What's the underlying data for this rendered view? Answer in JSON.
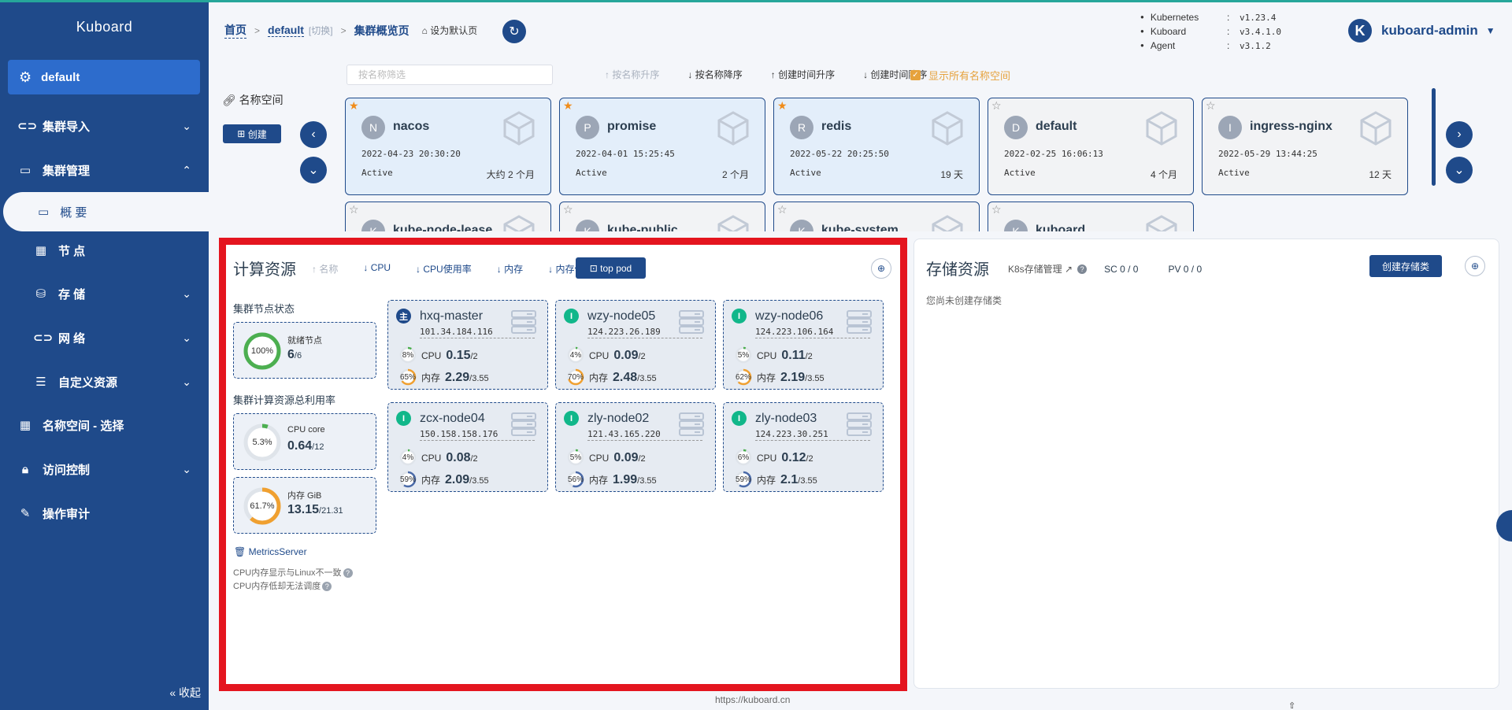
{
  "brand": "Kuboard",
  "sidebar": {
    "namespace": "default",
    "items": [
      {
        "label": "集群导入"
      },
      {
        "label": "集群管理"
      },
      {
        "label": "概 要"
      },
      {
        "label": "节 点"
      },
      {
        "label": "存 储"
      },
      {
        "label": "网 络"
      },
      {
        "label": "自定义资源"
      },
      {
        "label": "名称空间 - 选择"
      },
      {
        "label": "访问控制"
      },
      {
        "label": "操作审计"
      }
    ],
    "collapse": "收起"
  },
  "header": {
    "crumb_home": "首页",
    "crumb_cluster": "default",
    "crumb_switch": "[切换]",
    "crumb_current": "集群概览页",
    "set_default": "设为默认页",
    "versions": [
      {
        "name": "Kubernetes",
        "value": "v1.23.4"
      },
      {
        "name": "Kuboard",
        "value": "v3.4.1.0"
      },
      {
        "name": "Agent",
        "value": "v3.1.2"
      }
    ],
    "user_initial": "K",
    "user": "kuboard-admin"
  },
  "namespaces": {
    "label": "名称空间",
    "create": "创建",
    "filter_placeholder": "按名称筛选",
    "sorts": [
      "按名称升序",
      "按名称降序",
      "创建时间升序",
      "创建时间降序"
    ],
    "show_all": "显示所有名称空间",
    "cards": [
      {
        "initial": "N",
        "name": "nacos",
        "created": "2022-04-23 20:30:20",
        "status": "Active",
        "age": "大约 2 个月",
        "fav": true
      },
      {
        "initial": "P",
        "name": "promise",
        "created": "2022-04-01 15:25:45",
        "status": "Active",
        "age": "2 个月",
        "fav": true
      },
      {
        "initial": "R",
        "name": "redis",
        "created": "2022-05-22 20:25:50",
        "status": "Active",
        "age": "19 天",
        "fav": true
      },
      {
        "initial": "D",
        "name": "default",
        "created": "2022-02-25 16:06:13",
        "status": "Active",
        "age": "4 个月",
        "fav": false
      },
      {
        "initial": "I",
        "name": "ingress-nginx",
        "created": "2022-05-29 13:44:25",
        "status": "Active",
        "age": "12 天",
        "fav": false
      },
      {
        "initial": "K",
        "name": "kube-node-lease",
        "created": "",
        "status": "",
        "age": "",
        "fav": false
      },
      {
        "initial": "K",
        "name": "kube-public",
        "created": "",
        "status": "",
        "age": "",
        "fav": false
      },
      {
        "initial": "K",
        "name": "kube-system",
        "created": "",
        "status": "",
        "age": "",
        "fav": false
      },
      {
        "initial": "K",
        "name": "kuboard",
        "created": "",
        "status": "",
        "age": "",
        "fav": false
      }
    ]
  },
  "compute": {
    "title": "计算资源",
    "sorts": [
      "名称",
      "CPU",
      "CPU使用率",
      "内存",
      "内存使用率"
    ],
    "top_pod": "top pod",
    "node_status_title": "集群节点状态",
    "ready": {
      "label": "就绪节点",
      "pct": 100,
      "pct_text": "100%",
      "value": "6",
      "total": "/6"
    },
    "usage_title": "集群计算资源总利用率",
    "cpu": {
      "label": "CPU core",
      "pct": 5.3,
      "pct_text": "5.3%",
      "value": "0.64",
      "total": "/12"
    },
    "mem": {
      "label": "内存 GiB",
      "pct": 61.7,
      "pct_text": "61.7%",
      "value": "13.15",
      "total": "/21.31"
    },
    "metrics_server": "MetricsServer",
    "notes": [
      "CPU内存显示与Linux不一致",
      "CPU内存低却无法调度"
    ],
    "nodes": [
      {
        "role": "主",
        "name": "hxq-master",
        "ip": "101.34.184.116",
        "cpu_pct": 8,
        "cpu": "0.15",
        "cpu_total": "/2",
        "mem_pct": 65,
        "mem": "2.29",
        "mem_total": "/3.55"
      },
      {
        "role": "I",
        "name": "wzy-node05",
        "ip": "124.223.26.189",
        "cpu_pct": 4,
        "cpu": "0.09",
        "cpu_total": "/2",
        "mem_pct": 70,
        "mem": "2.48",
        "mem_total": "/3.55"
      },
      {
        "role": "I",
        "name": "wzy-node06",
        "ip": "124.223.106.164",
        "cpu_pct": 5,
        "cpu": "0.11",
        "cpu_total": "/2",
        "mem_pct": 62,
        "mem": "2.19",
        "mem_total": "/3.55"
      },
      {
        "role": "I",
        "name": "zcx-node04",
        "ip": "150.158.158.176",
        "cpu_pct": 4,
        "cpu": "0.08",
        "cpu_total": "/2",
        "mem_pct": 59,
        "mem": "2.09",
        "mem_total": "/3.55"
      },
      {
        "role": "I",
        "name": "zly-node02",
        "ip": "121.43.165.220",
        "cpu_pct": 5,
        "cpu": "0.09",
        "cpu_total": "/2",
        "mem_pct": 56,
        "mem": "1.99",
        "mem_total": "/3.55"
      },
      {
        "role": "I",
        "name": "zly-node03",
        "ip": "124.223.30.251",
        "cpu_pct": 6,
        "cpu": "0.12",
        "cpu_total": "/2",
        "mem_pct": 59,
        "mem": "2.1",
        "mem_total": "/3.55"
      }
    ],
    "cpu_label": "CPU",
    "mem_label": "内存"
  },
  "storage": {
    "title": "存储资源",
    "mgmt": "K8s存储管理",
    "sc": "SC 0 / 0",
    "pv": "PV 0 / 0",
    "create": "创建存储类",
    "empty": "您尚未创建存储类"
  },
  "footer": "https://kuboard.cn",
  "colors": {
    "primary": "#1f4a8a",
    "accent": "#e6a23c",
    "frame": "#e4151f",
    "ready": "#4caf50",
    "mem": "#f0a030",
    "node_ok": "#11b78a"
  }
}
